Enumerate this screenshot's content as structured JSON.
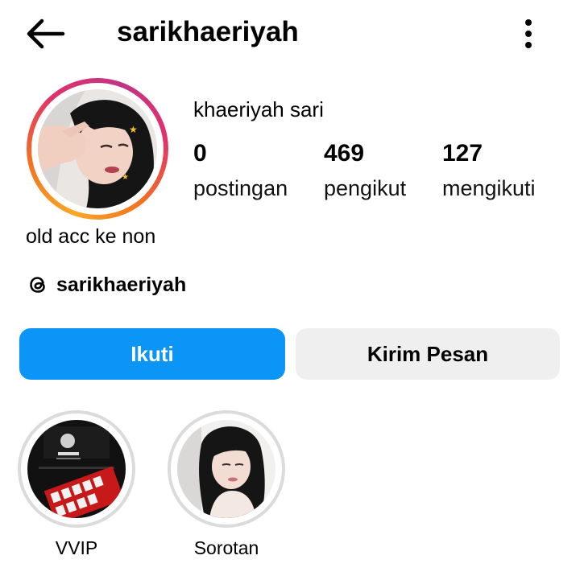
{
  "header": {
    "username": "sarikhaeriyah",
    "back_icon": "arrow-left-icon",
    "more_icon": "more-vertical-icon"
  },
  "profile": {
    "full_name": "khaeriyah sari",
    "bio": "old acc ke non",
    "stats": [
      {
        "value": "0",
        "label": "postingan"
      },
      {
        "value": "469",
        "label": "pengikut"
      },
      {
        "value": "127",
        "label": "mengikuti"
      }
    ],
    "threads": {
      "icon": "threads-icon",
      "handle": "sarikhaeriyah"
    }
  },
  "actions": {
    "follow_label": "Ikuti",
    "message_label": "Kirim Pesan"
  },
  "highlights": [
    {
      "label": "VVIP"
    },
    {
      "label": "Sorotan"
    }
  ],
  "colors": {
    "follow_button": "#0b95f6",
    "message_button": "#efefef",
    "story_ring_start": "#f9a826",
    "story_ring_end": "#c13584",
    "highlight_ring": "#dbdbdb"
  }
}
